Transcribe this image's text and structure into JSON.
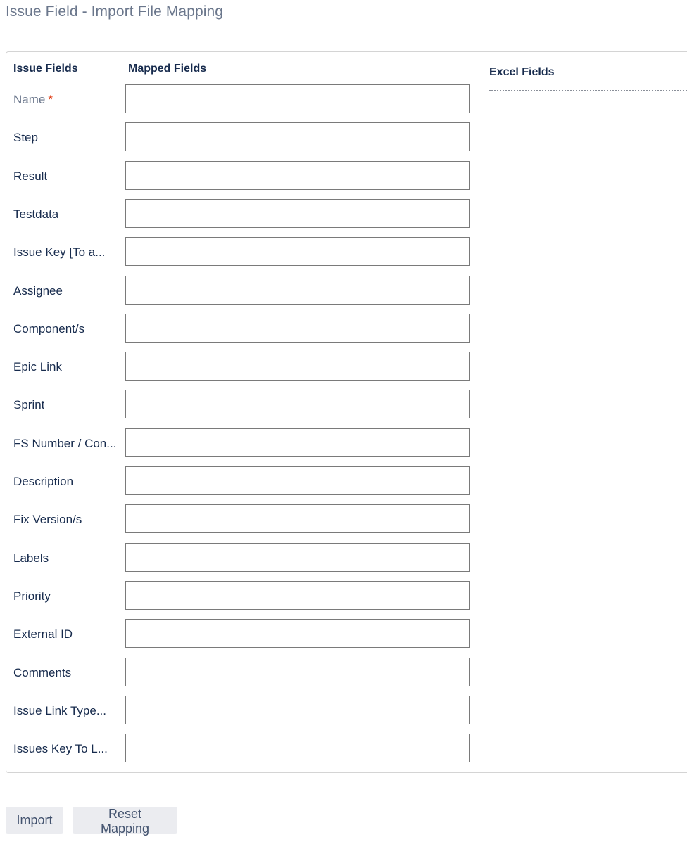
{
  "page": {
    "title": "Issue Field - Import File Mapping"
  },
  "columns": {
    "issue_fields": "Issue Fields",
    "mapped_fields": "Mapped Fields",
    "excel_fields": "Excel Fields"
  },
  "fields": [
    {
      "label": "Name",
      "required": true,
      "required_mark": "*",
      "mapped_value": ""
    },
    {
      "label": "Step",
      "required": false,
      "mapped_value": ""
    },
    {
      "label": "Result",
      "required": false,
      "mapped_value": ""
    },
    {
      "label": "Testdata",
      "required": false,
      "mapped_value": ""
    },
    {
      "label": "Issue Key [To a...",
      "required": false,
      "mapped_value": ""
    },
    {
      "label": "Assignee",
      "required": false,
      "mapped_value": ""
    },
    {
      "label": "Component/s",
      "required": false,
      "mapped_value": ""
    },
    {
      "label": "Epic Link",
      "required": false,
      "mapped_value": ""
    },
    {
      "label": "Sprint",
      "required": false,
      "mapped_value": ""
    },
    {
      "label": "FS Number / Con...",
      "required": false,
      "mapped_value": ""
    },
    {
      "label": "Description",
      "required": false,
      "mapped_value": ""
    },
    {
      "label": "Fix Version/s",
      "required": false,
      "mapped_value": ""
    },
    {
      "label": "Labels",
      "required": false,
      "mapped_value": ""
    },
    {
      "label": "Priority",
      "required": false,
      "mapped_value": ""
    },
    {
      "label": "External ID",
      "required": false,
      "mapped_value": ""
    },
    {
      "label": "Comments",
      "required": false,
      "mapped_value": ""
    },
    {
      "label": "Issue Link Type...",
      "required": false,
      "mapped_value": ""
    },
    {
      "label": "Issues Key To L...",
      "required": false,
      "mapped_value": ""
    }
  ],
  "excel_fields": [],
  "buttons": {
    "import": "Import",
    "reset_mapping": "Reset Mapping"
  },
  "colors": {
    "title": "#6b778c",
    "heading": "#172b4d",
    "required_star": "#de350b",
    "button_bg": "#ebecf0",
    "button_text": "#42526e"
  }
}
